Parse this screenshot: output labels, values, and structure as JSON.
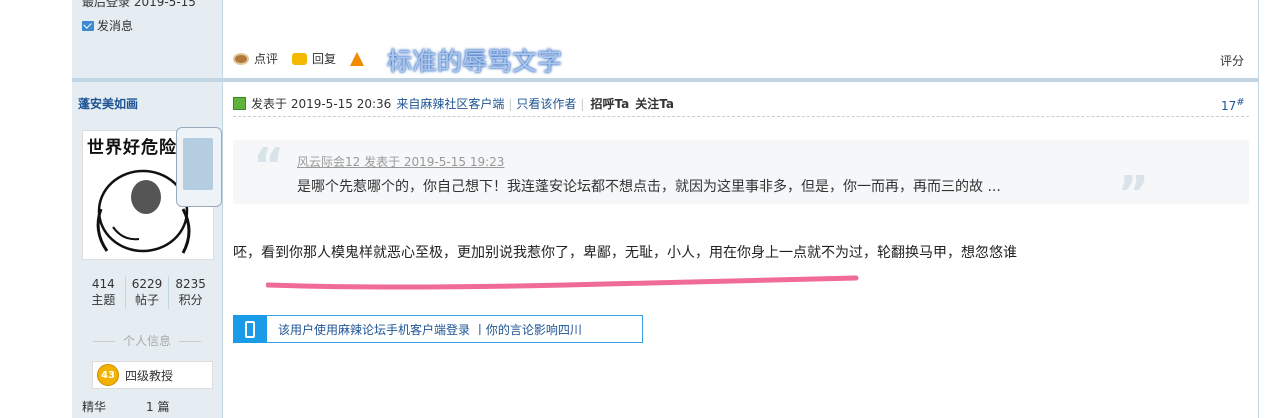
{
  "prev_post": {
    "last_login": "最后登录  2019-5-15",
    "send_pm": "发消息",
    "actions": {
      "comment": "点评",
      "reply": "回复",
      "support": "支持"
    },
    "overlay_text": "标准的辱骂文字",
    "rate": "评分"
  },
  "author": {
    "name": "蓬安美如画",
    "avatar_caption": "世界好危险",
    "stats": [
      {
        "value": "414",
        "label": "主题"
      },
      {
        "value": "6229",
        "label": "帖子"
      },
      {
        "value": "8235",
        "label": "积分"
      }
    ],
    "personal_info_label": "个人信息",
    "rank_level": "43",
    "rank_title": "四级教授",
    "digest_label": "精华",
    "digest_value": "1 篇"
  },
  "post": {
    "posted_at": "发表于 2019-5-15 20:36",
    "source": "来自麻辣社区客户端",
    "separator": "|",
    "only_author": "只看该作者",
    "greet": "招呼Ta",
    "follow": "关注Ta",
    "floor": "17",
    "floor_suffix": "#",
    "quote": {
      "author_line": "风云际会12 发表于 2019-5-15 19:23",
      "text": "是哪个先惹哪个的，你自己想下！我连蓬安论坛都不想点击，就因为这里事非多，但是，你一而再，再而三的故 ..."
    },
    "body": "呸，看到你那人模鬼样就恶心至极，更加别说我惹你了，卑鄙，无耻，小人，用在你身上一点就不为过，轮翻换马甲，想忽悠谁",
    "mobile_banner": "该用户使用麻辣论坛手机客户端登录  丨你的言论影响四川"
  },
  "colors": {
    "sidebar_bg": "#e5edf2",
    "link": "#1e5494",
    "annotation_pink": "#f06a9a"
  }
}
